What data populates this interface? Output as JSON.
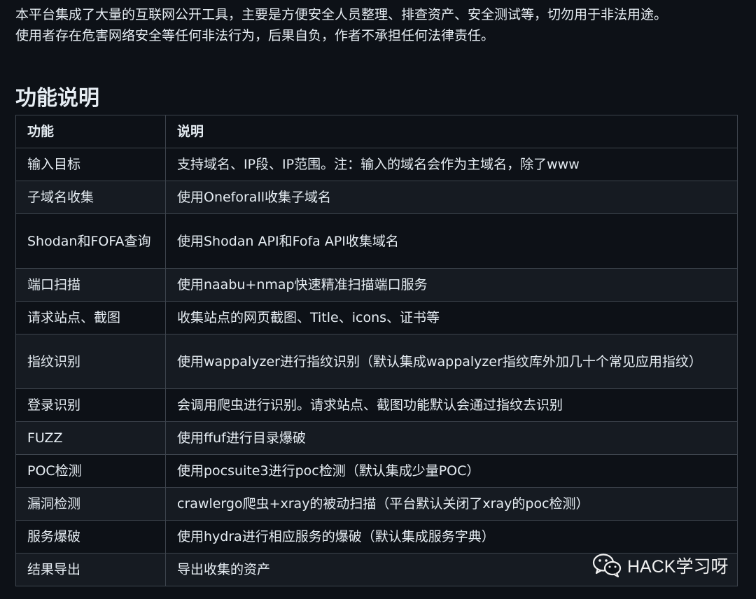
{
  "intro": {
    "line1": "本平台集成了大量的互联网公开工具，主要是方便安全人员整理、排查资产、安全测试等，切勿用于非法用途。",
    "line2": "使用者存在危害网络安全等任何非法行为，后果自负，作者不承担任何法律责任。"
  },
  "section": {
    "title": "功能说明"
  },
  "table": {
    "headers": [
      "功能",
      "说明"
    ],
    "rows": [
      [
        "输入目标",
        "支持域名、IP段、IP范围。注：输入的域名会作为主域名，除了www"
      ],
      [
        "子域名收集",
        "使用Oneforall收集子域名"
      ],
      [
        "Shodan和FOFA查询",
        "使用Shodan API和Fofa API收集域名"
      ],
      [
        "端口扫描",
        "使用naabu+nmap快速精准扫描端口服务"
      ],
      [
        "请求站点、截图",
        "收集站点的网页截图、Title、icons、证书等"
      ],
      [
        "指纹识别",
        "使用wappalyzer进行指纹识别（默认集成wappalyzer指纹库外加几十个常见应用指纹）"
      ],
      [
        "登录识别",
        "会调用爬虫进行识别。请求站点、截图功能默认会通过指纹去识别"
      ],
      [
        "FUZZ",
        "使用ffuf进行目录爆破"
      ],
      [
        "POC检测",
        "使用pocsuite3进行poc检测（默认集成少量POC）"
      ],
      [
        "漏洞检测",
        "crawlergo爬虫+xray的被动扫描（平台默认关闭了xray的poc检测）"
      ],
      [
        "服务爆破",
        "使用hydra进行相应服务的爆破（默认集成服务字典）"
      ],
      [
        "结果导出",
        "导出收集的资产"
      ]
    ]
  },
  "watermark": {
    "icon": "wechat-icon",
    "text": "HACK学习呀"
  }
}
